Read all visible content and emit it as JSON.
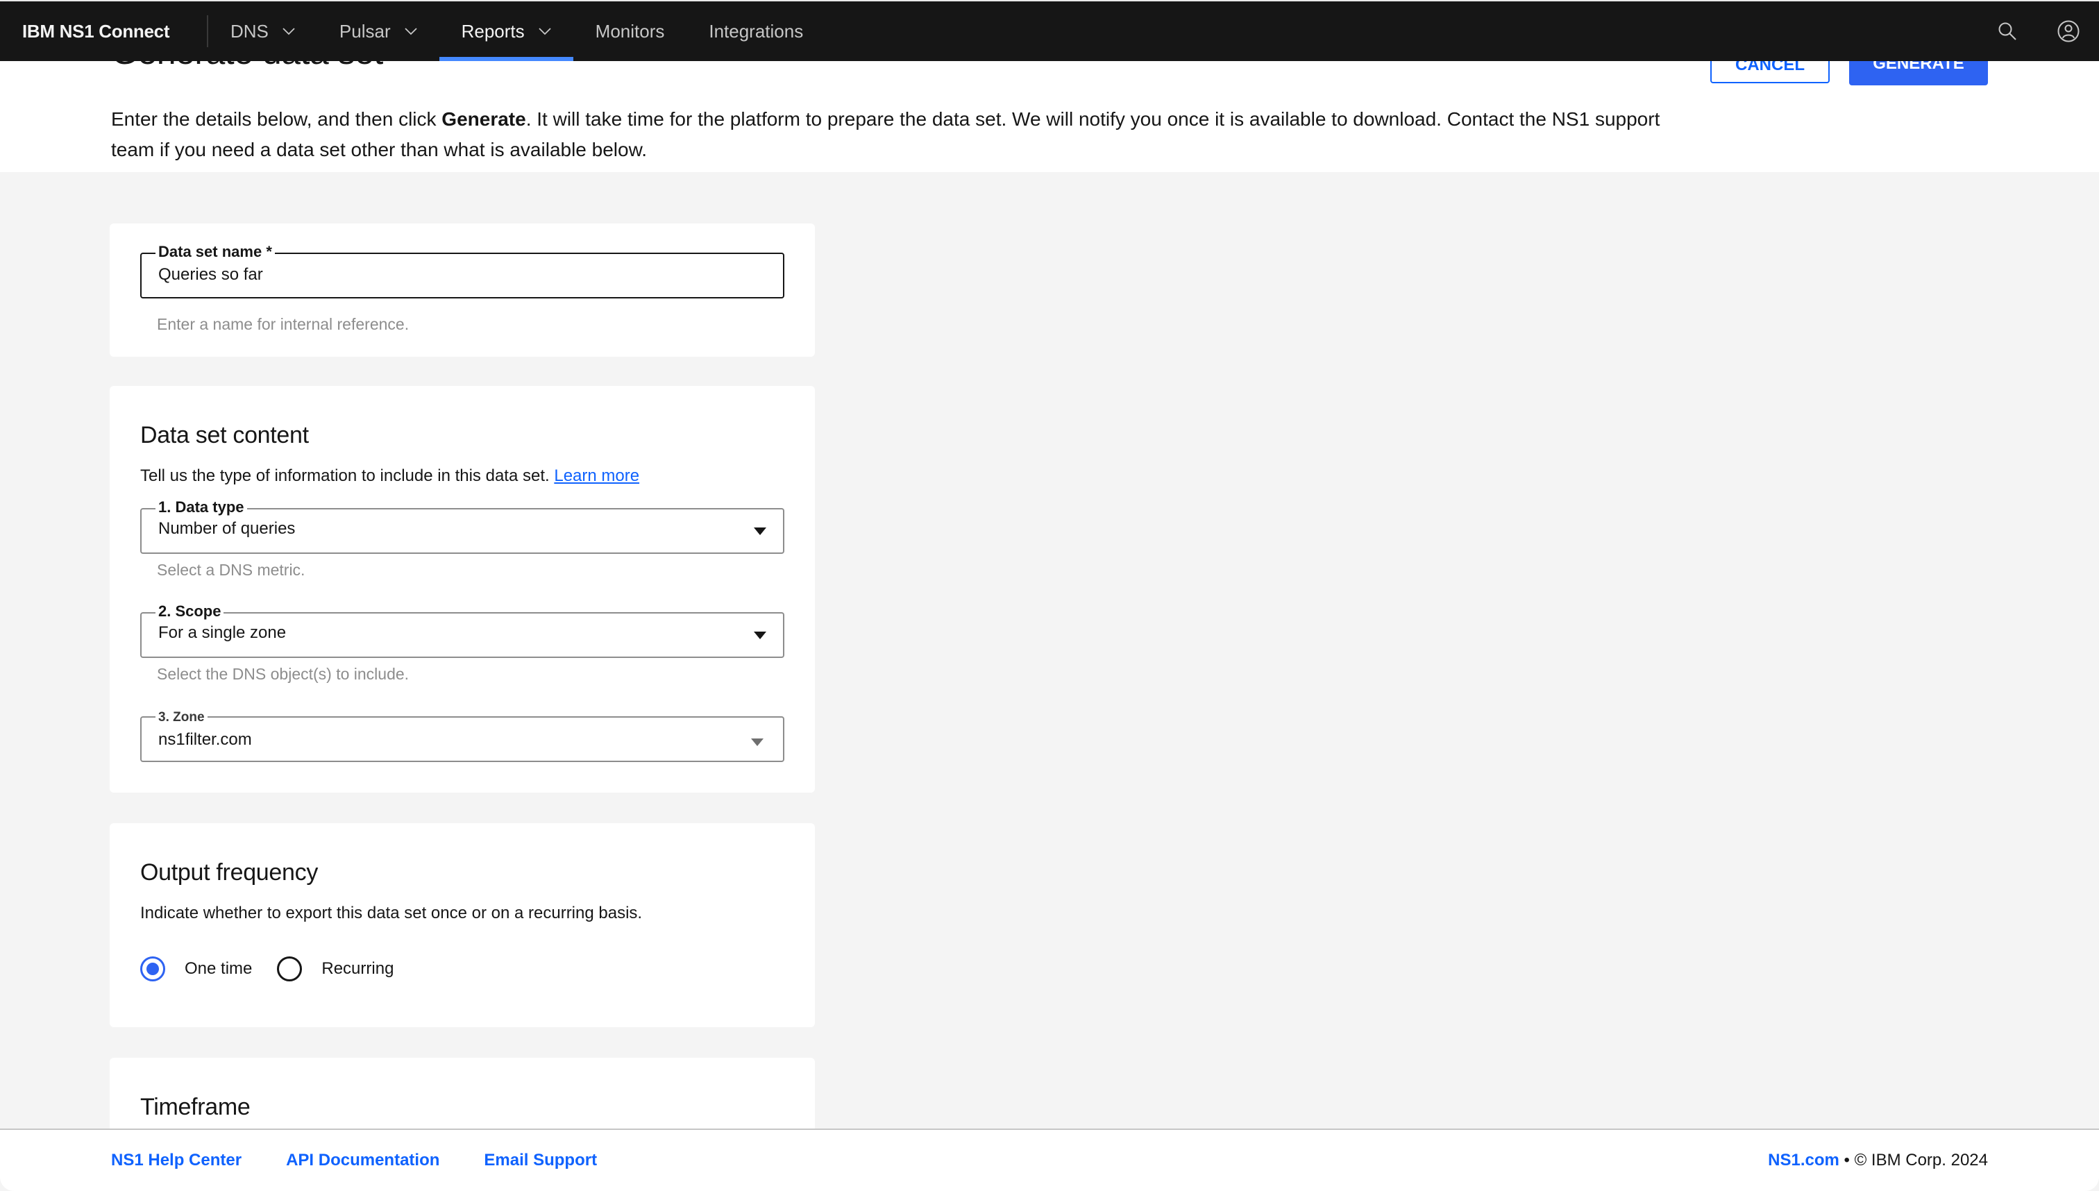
{
  "nav": {
    "brand": "IBM NS1 Connect",
    "items": [
      {
        "label": "DNS",
        "has_dropdown": true,
        "active": false
      },
      {
        "label": "Pulsar",
        "has_dropdown": true,
        "active": false
      },
      {
        "label": "Reports",
        "has_dropdown": true,
        "active": true
      },
      {
        "label": "Monitors",
        "has_dropdown": false,
        "active": false
      },
      {
        "label": "Integrations",
        "has_dropdown": false,
        "active": false
      }
    ],
    "icons": [
      "search-icon",
      "user-avatar-icon"
    ]
  },
  "header": {
    "title": "Generate data set",
    "cancel_label": "CANCEL",
    "generate_label": "GENERATE",
    "intro_before": "Enter the details below, and then click ",
    "intro_bold": "Generate",
    "intro_after": ". It will take time for the platform to prepare the data set. We will notify you once it is available to download. Contact the NS1 support team if you need a data set other than what is available below."
  },
  "name_card": {
    "label": "Data set name",
    "required_mark": "*",
    "value": "Queries so far",
    "helper": "Enter a name for internal reference."
  },
  "content_card": {
    "title": "Data set content",
    "description": "Tell us the type of information to include in this data set.",
    "learn_more": "Learn more",
    "data_type": {
      "label": "1. Data type",
      "value": "Number of queries",
      "helper": "Select a DNS metric."
    },
    "scope": {
      "label": "2. Scope",
      "value": "For a single zone",
      "helper": "Select the DNS object(s) to include."
    },
    "zone": {
      "label": "3. Zone",
      "value": "ns1filter.com"
    }
  },
  "frequency_card": {
    "title": "Output frequency",
    "description": "Indicate whether to export this data set once or on a recurring basis.",
    "options": [
      {
        "label": "One time",
        "checked": true
      },
      {
        "label": "Recurring",
        "checked": false
      }
    ]
  },
  "timeframe_card": {
    "title": "Timeframe"
  },
  "footer": {
    "links": [
      "NS1 Help Center",
      "API Documentation",
      "Email Support"
    ],
    "site_link": "NS1.com",
    "copyright": " • © IBM Corp. 2024"
  },
  "colors": {
    "nav_bg": "#161616",
    "accent": "#2e63f2",
    "active_tab_underline": "#4589ff",
    "page_bg": "#f4f4f4"
  }
}
